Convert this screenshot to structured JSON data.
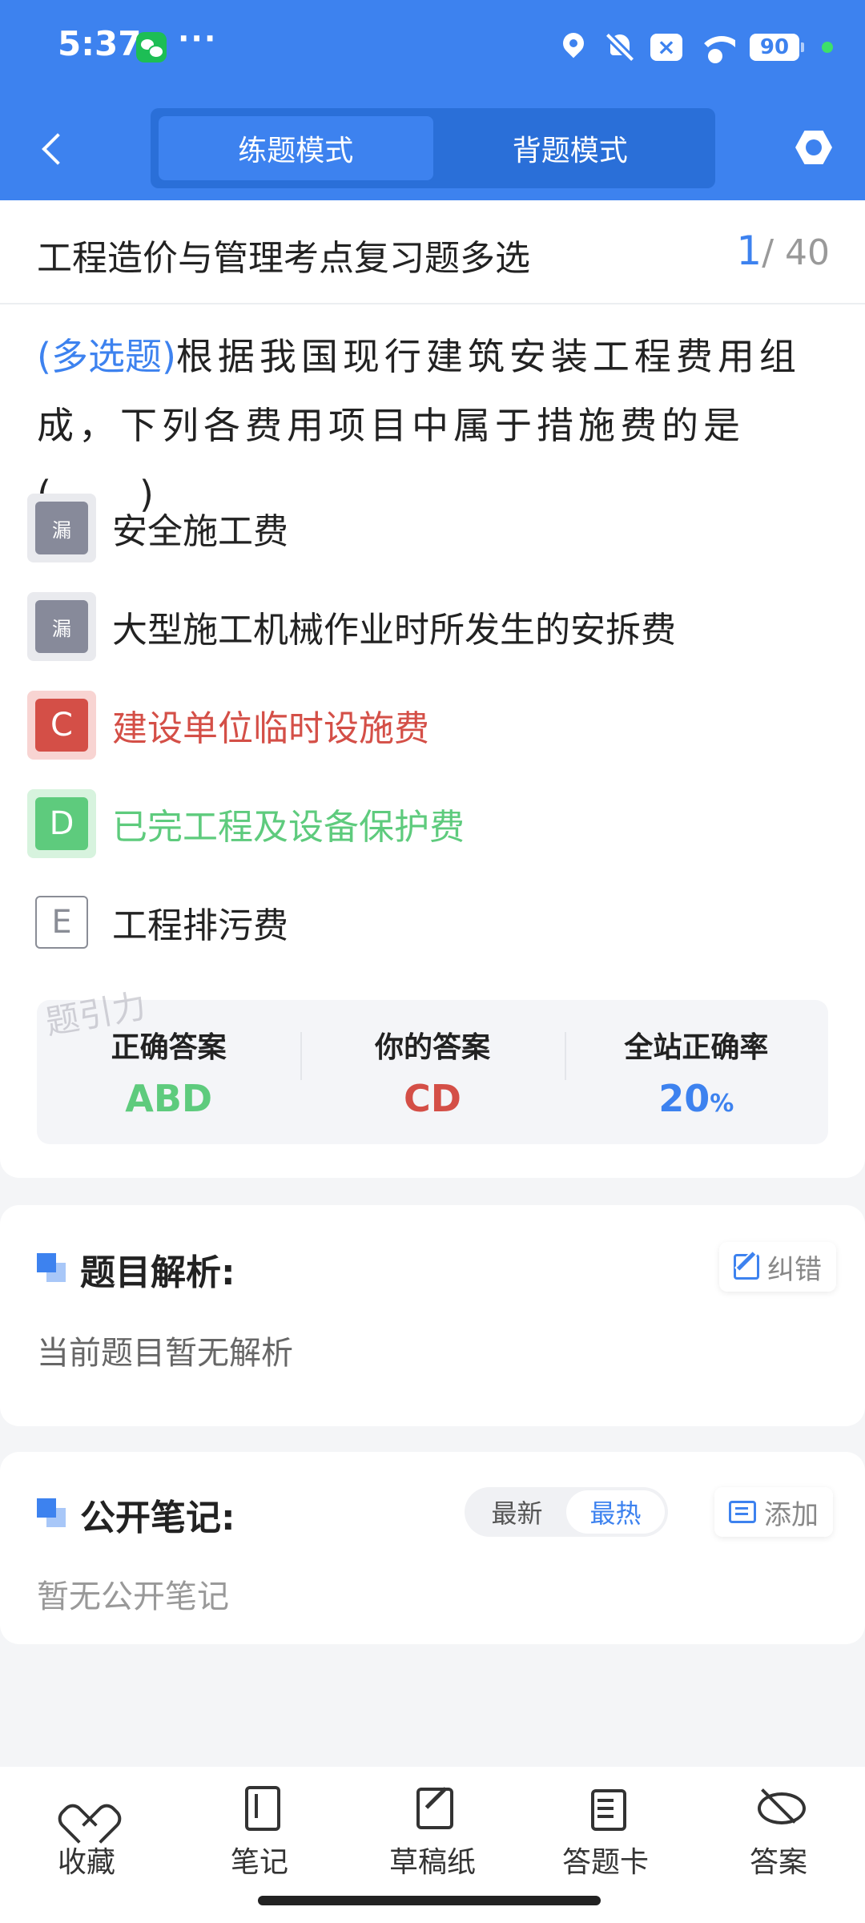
{
  "status_bar": {
    "time": "5:37",
    "more": "···",
    "battery": "90"
  },
  "header": {
    "tabs": [
      {
        "label": "练题模式",
        "active": true
      },
      {
        "label": "背题模式",
        "active": false
      }
    ]
  },
  "paper": {
    "title": "工程造价与管理考点复习题多选",
    "current": "1",
    "total": "/ 40"
  },
  "question": {
    "type": "(多选题)",
    "text": "根据我国现行建筑安装工程费用组成，下列各费用项目中属于措施费的是(　　)"
  },
  "options": [
    {
      "badge": "漏",
      "text": "安全施工费",
      "state": "missed"
    },
    {
      "badge": "漏",
      "text": "大型施工机械作业时所发生的安拆费",
      "state": "missed"
    },
    {
      "badge": "C",
      "text": "建设单位临时设施费",
      "state": "wrong"
    },
    {
      "badge": "D",
      "text": "已完工程及设备保护费",
      "state": "right"
    },
    {
      "badge": "E",
      "text": "工程排污费",
      "state": "plain"
    }
  ],
  "answer": {
    "watermark": "题引力",
    "correct_label": "正确答案",
    "correct_value": "ABD",
    "yours_label": "你的答案",
    "yours_value": "CD",
    "rate_label": "全站正确率",
    "rate_value": "20",
    "rate_unit": "%"
  },
  "analysis": {
    "heading": "题目解析:",
    "report_label": "纠错",
    "content": "当前题目暂无解析"
  },
  "notes": {
    "heading": "公开笔记:",
    "sort_options": [
      "最新",
      "最热"
    ],
    "sort_active": "最热",
    "add_label": "添加",
    "empty": "暂无公开笔记"
  },
  "bottom_nav": [
    {
      "label": "收藏",
      "icon": "heart-icon"
    },
    {
      "label": "笔记",
      "icon": "notebook-icon"
    },
    {
      "label": "草稿纸",
      "icon": "draft-paper-icon"
    },
    {
      "label": "答题卡",
      "icon": "answer-card-icon"
    },
    {
      "label": "答案",
      "icon": "eye-off-icon"
    }
  ],
  "colors": {
    "primary": "#3d82ef",
    "correct": "#5ecb7d",
    "wrong": "#d44f47",
    "missed": "#878a9a"
  }
}
